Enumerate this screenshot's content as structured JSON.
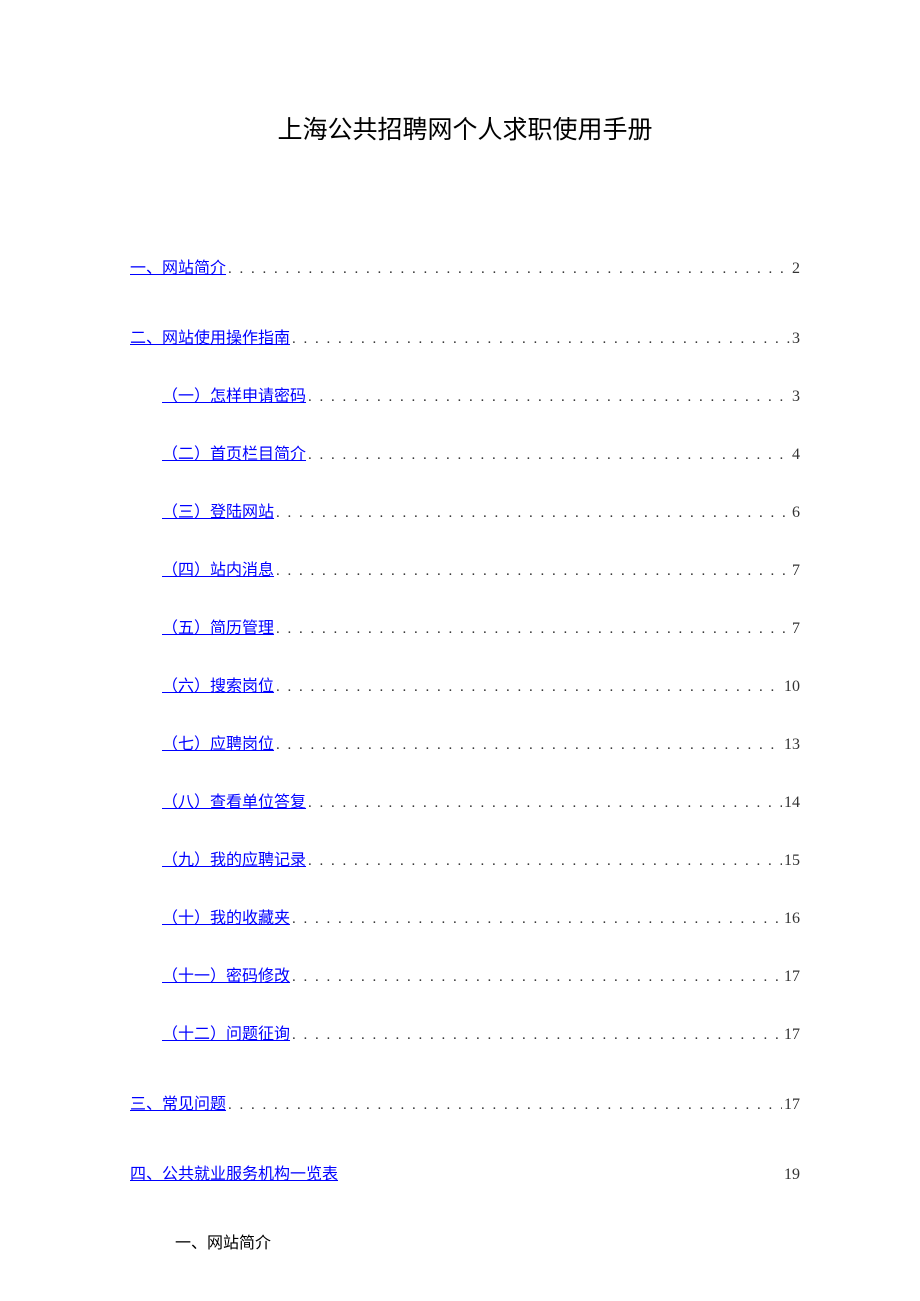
{
  "title": "上海公共招聘网个人求职使用手册",
  "toc": [
    {
      "level": 1,
      "label": "一、网站简介",
      "page": "2",
      "dots": true
    },
    {
      "level": 1,
      "label": "二、网站使用操作指南",
      "page": "3",
      "dots": true,
      "gap": true
    },
    {
      "level": 2,
      "label": "（一）怎样申请密码",
      "page": "3",
      "dots": true
    },
    {
      "level": 2,
      "label": "（二）首页栏目简介",
      "page": "4",
      "dots": true
    },
    {
      "level": 2,
      "label": "（三）登陆网站",
      "page": "6",
      "dots": true
    },
    {
      "level": 2,
      "label": "（四）站内消息",
      "page": "7",
      "dots": true
    },
    {
      "level": 2,
      "label": "（五）简历管理",
      "page": "7",
      "dots": true
    },
    {
      "level": 2,
      "label": "（六）搜索岗位",
      "page": "10",
      "dots": true
    },
    {
      "level": 2,
      "label": "（七）应聘岗位",
      "page": "13",
      "dots": true
    },
    {
      "level": 2,
      "label": "（八）查看单位答复",
      "page": "14",
      "dots": true
    },
    {
      "level": 2,
      "label": "（九）我的应聘记录",
      "page": "15",
      "dots": true
    },
    {
      "level": 2,
      "label": "（十）我的收藏夹",
      "page": "16",
      "dots": true
    },
    {
      "level": 2,
      "label": "（十一）密码修改",
      "page": "17",
      "dots": true
    },
    {
      "level": 2,
      "label": "（十二）问题征询",
      "page": "17",
      "dots": true
    },
    {
      "level": 1,
      "label": "三、常见问题",
      "page": "17",
      "dots": true,
      "gap": true
    },
    {
      "level": 1,
      "label": "四、公共就业服务机构一览表",
      "page": "19",
      "dots": false,
      "gap": true
    }
  ],
  "section_heading": "一、网站简介"
}
